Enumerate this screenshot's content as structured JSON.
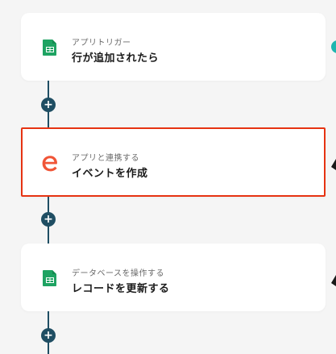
{
  "flow": {
    "steps": [
      {
        "subtitle": "アプリトリガー",
        "title": "行が追加されたら",
        "icon": "google-sheets-icon"
      },
      {
        "subtitle": "アプリと連携する",
        "title": "イベントを作成",
        "icon": "eventbrite-icon"
      },
      {
        "subtitle": "データベースを操作する",
        "title": "レコードを更新する",
        "icon": "google-sheets-icon"
      }
    ],
    "add_button_symbol": "+"
  },
  "colors": {
    "connector": "#1f4e63",
    "selected_border": "#e63312",
    "sheets_green": "#1ea362",
    "eventbrite_orange": "#f05537"
  }
}
